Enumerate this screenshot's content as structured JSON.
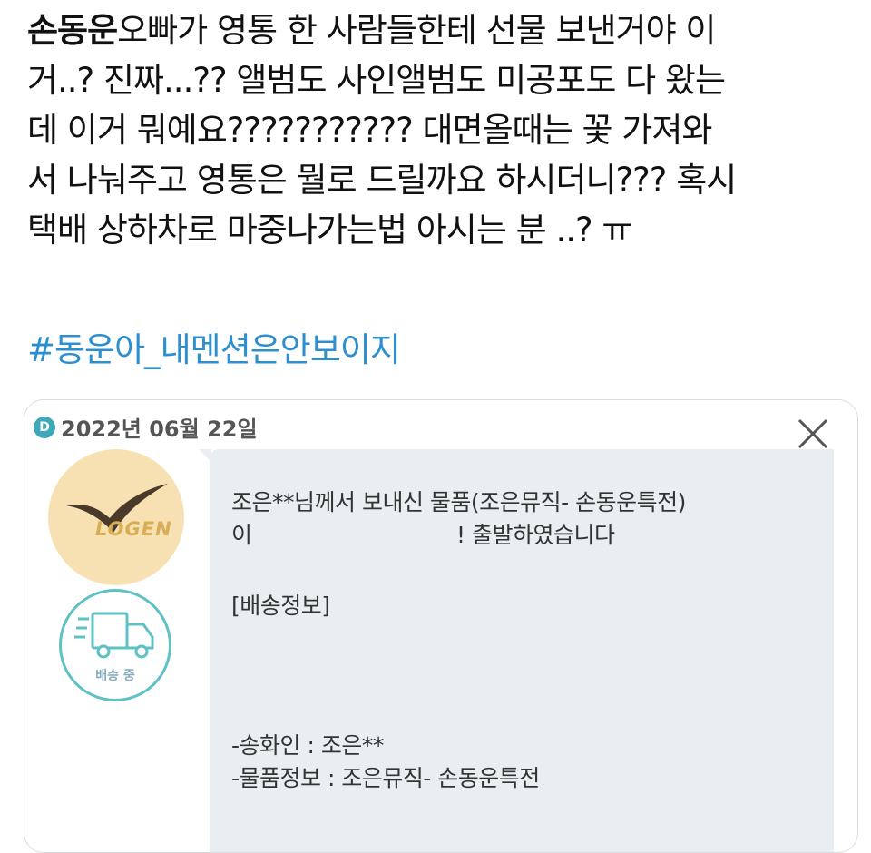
{
  "tweet": {
    "mention": "손동운",
    "body": "오빠가 영통 한 사람들한테 선물 보낸거야 이\n거..? 진짜...?? 앨범도 사인앨범도 미공포도 다 왔는\n데 이거 뭐예요??????????? 대면올때는 꽃 가져와\n서 나눠주고 영통은 뭘로 드릴까요 하시더니??? 혹시\n택배 상하차로 마중나가는법 아시는 분 ..? ㅠ",
    "hashtag": "#동운아_내멘션은안보이지"
  },
  "notification": {
    "badge": "D",
    "date": "2022년 06월 22일",
    "logo_text": "LOGEN",
    "status_label": "배송 중",
    "line1": "조은**님께서 보내신 물품(조은뮤직- 손동운특전)",
    "line2a": "이",
    "line2b": "! 출발하였습니다",
    "section": "[배송정보]",
    "sender": "-송화인 : 조은**",
    "item": "-물품정보 : 조은뮤직- 손동운특전"
  },
  "colors": {
    "hashtag": "#2e8fcf",
    "badge": "#3fa8b8",
    "logo_bg": "#f7e1b3",
    "logo_bird": "#4a3a2a",
    "logo_text": "#d9ad55",
    "truck": "#5fc1c4",
    "bubble": "#e9eef1"
  },
  "icons": [
    "close-icon",
    "logen-bird-icon",
    "truck-icon"
  ]
}
